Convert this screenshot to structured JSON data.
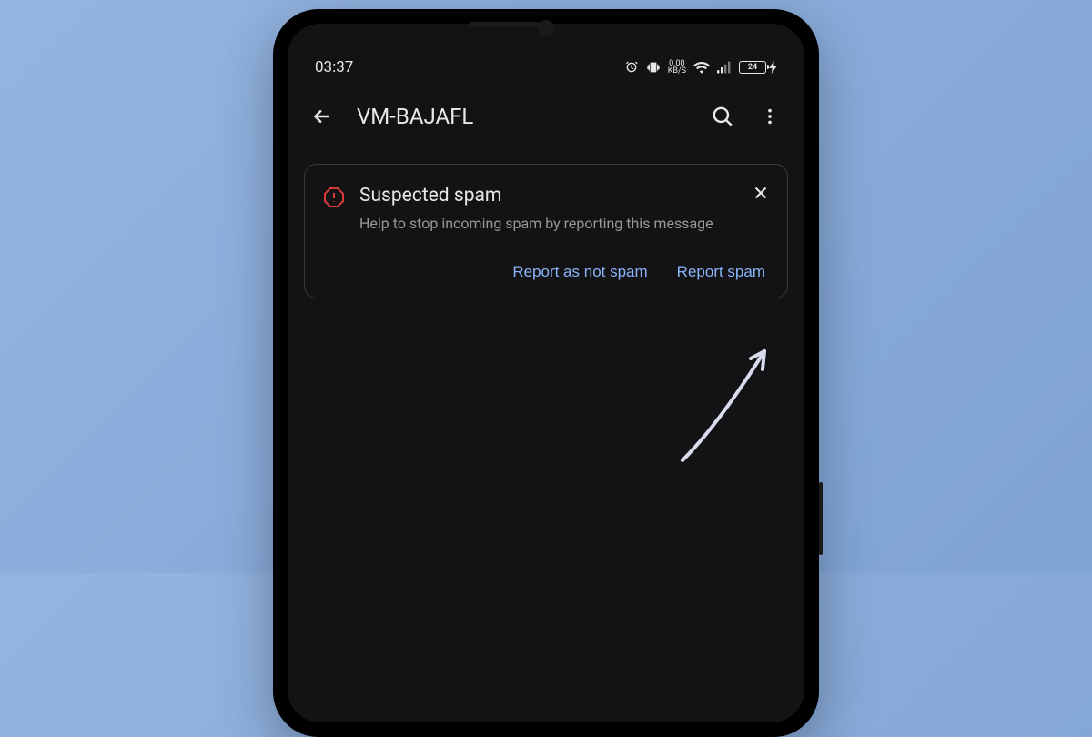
{
  "status_bar": {
    "time": "03:37",
    "data_rate_value": "0.00",
    "data_rate_unit": "KB/S",
    "battery_percent": "24"
  },
  "header": {
    "title": "VM-BAJAFL"
  },
  "spam_card": {
    "title": "Suspected spam",
    "subtitle": "Help to stop incoming spam by reporting this message",
    "action_not_spam": "Report as not spam",
    "action_spam": "Report spam"
  }
}
